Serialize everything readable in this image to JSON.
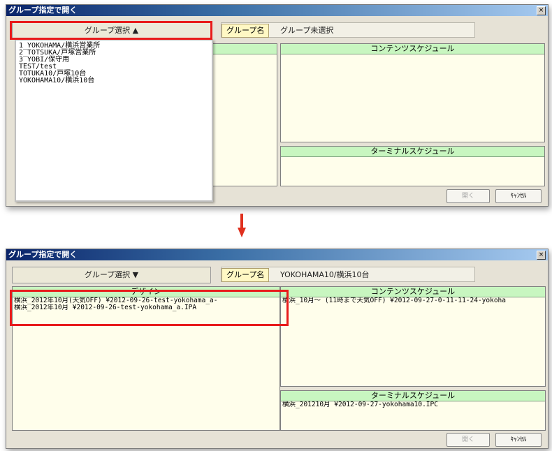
{
  "window_top": {
    "title": "グループ指定で開く",
    "close": "×",
    "group_select": "グループ選択 ▲",
    "group_name_label": "グループ名",
    "group_name_value": "グループ未選択",
    "contents_schedule": "コンテンツスケジュール",
    "terminal_schedule": "ターミナルスケジュール",
    "open_button": "開く",
    "cancel_button": "ｷｬﾝｾﾙ",
    "dropdown_items": [
      "1_YOKOHAMA/横浜営業所",
      "2_TOTSUKA/戸塚営業所",
      "3_YOBI/保守用",
      "TEST/test",
      "TOTUKA10/戸塚10台",
      "YOKOHAMA10/横浜10台"
    ]
  },
  "window_bottom": {
    "title": "グループ指定で開く",
    "close": "×",
    "group_select": "グループ選択 ▼",
    "group_name_label": "グループ名",
    "group_name_value": "YOKOHAMA10/横浜10台",
    "design": "デザイン",
    "design_rows": [
      "横浜_2012年10月(天気OFF)      ¥2012-09-26-test-yokohama_a-",
      "横浜_2012年10月 ¥2012-09-26-test-yokohama_a.IPA"
    ],
    "contents_schedule": "コンテンツスケジュール",
    "contents_rows": [
      "横浜_10月～ (11時まで天気OFF)   ¥2012-09-27-0-11-11-24-yokoha"
    ],
    "terminal_schedule": "ターミナルスケジュール",
    "terminal_rows": [
      "横浜_201210月   ¥2012-09-27-yokohama10.IPC"
    ],
    "open_button": "開く",
    "cancel_button": "ｷｬﾝｾﾙ"
  },
  "colors": {
    "highlight": "#e81b1b",
    "header_green": "#c8f6c0",
    "panel_bg": "#fffeeb",
    "arrow": "#e0301e"
  }
}
